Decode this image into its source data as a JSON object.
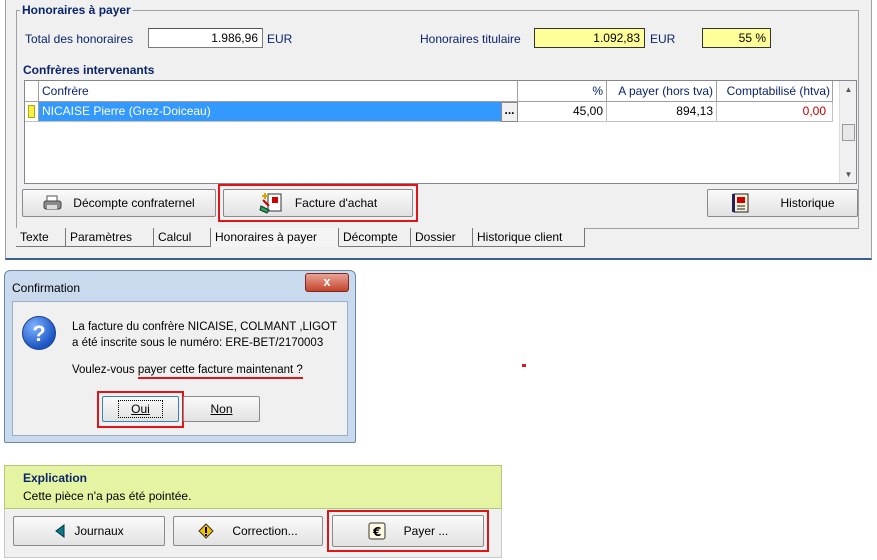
{
  "honoraires": {
    "legend": "Honoraires à payer",
    "total_label": "Total des honoraires",
    "total_value": "1.986,96",
    "total_unit": "EUR",
    "titulaire_label": "Honoraires titulaire",
    "titulaire_value": "1.092,83",
    "titulaire_unit": "EUR",
    "percent_value": "55 %",
    "confreres_label": "Confrères intervenants",
    "columns": [
      "Confrère",
      "%",
      "A payer (hors tva)",
      "Comptabilisé (htva)"
    ],
    "rows": [
      {
        "confrere": "NICAISE Pierre (Grez-Doiceau)",
        "ellipsis": "...",
        "pct": "45,00",
        "a_payer": "894,13",
        "comptabilise": "0,00"
      }
    ],
    "buttons": {
      "decompte": "Décompte confraternel",
      "facture": "Facture d'achat",
      "historique": "Historique"
    },
    "tabs": [
      "Texte",
      "Paramètres",
      "Calcul",
      "Honoraires à payer",
      "Décompte",
      "Dossier",
      "Historique client"
    ],
    "active_tab": "Honoraires à payer"
  },
  "dialog": {
    "title": "Confirmation",
    "close": "x",
    "message_line1": "La facture du confrère NICAISE, COLMANT ,LIGOT",
    "message_line2": "a été inscrite sous le numéro: ERE-BET/2170003",
    "question_prefix": "Voulez-vous ",
    "question_underlined": "payer cette facture maintenant ?",
    "yes": "Oui",
    "no": "Non"
  },
  "explication": {
    "title": "Explication",
    "text": "Cette pièce n'a pas été pointée.",
    "buttons": {
      "journaux": "Journaux",
      "correction": "Correction...",
      "payer": "Payer ..."
    }
  },
  "colors": {
    "highlight": "#e0151a",
    "yellow_field": "#ffff99",
    "selection": "#3399ff",
    "explication_bg": "#e5f4a3"
  }
}
